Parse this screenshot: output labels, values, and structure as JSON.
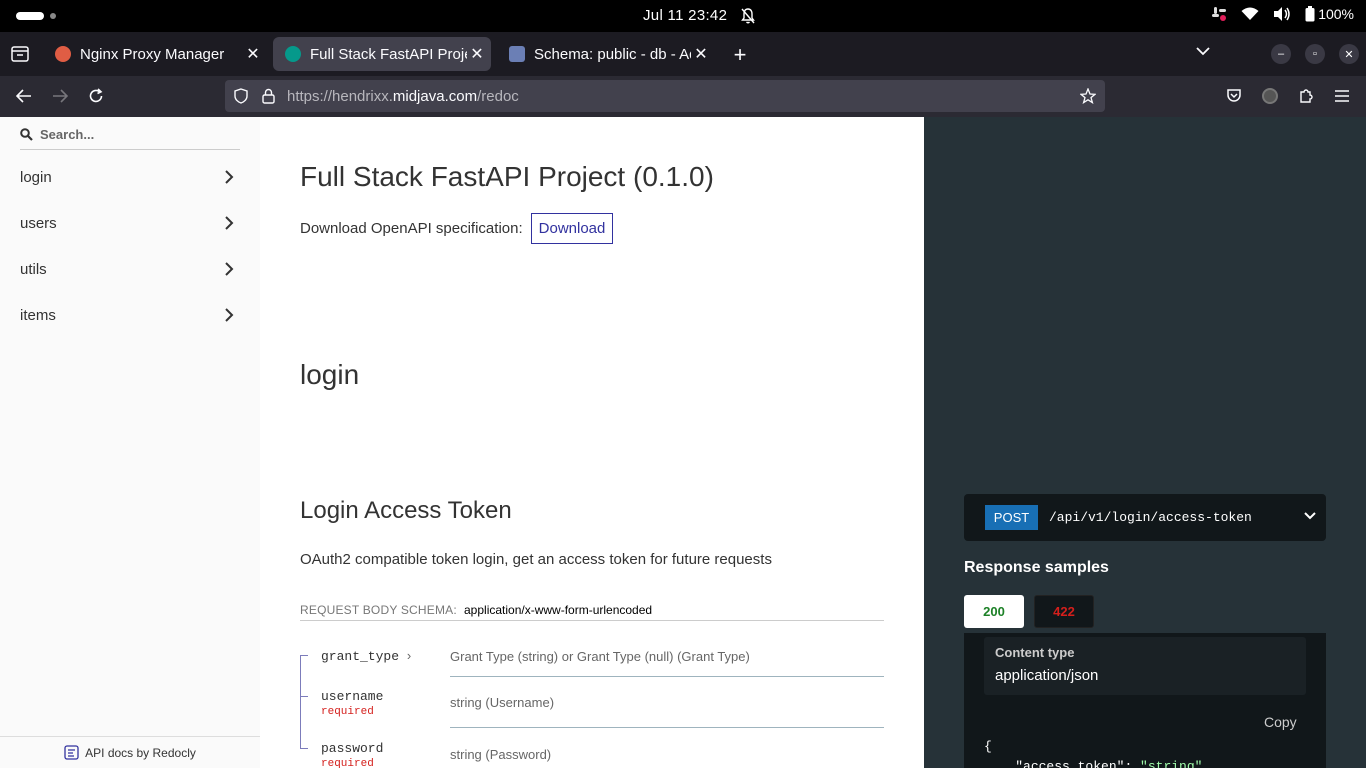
{
  "system": {
    "clock": "Jul 11  23:42",
    "battery": "100%"
  },
  "browser": {
    "tabs": [
      {
        "label": "Nginx Proxy Manager"
      },
      {
        "label": "Full Stack FastAPI Project"
      },
      {
        "label": "Schema: public - db - Adminer"
      }
    ],
    "url_prefix": "https://hendrixx.",
    "url_host": "midjava.com",
    "url_path": "/redoc"
  },
  "sidebar": {
    "search_placeholder": "Search...",
    "items": [
      {
        "label": "login"
      },
      {
        "label": "users"
      },
      {
        "label": "utils"
      },
      {
        "label": "items"
      }
    ],
    "footer": "API docs by Redocly"
  },
  "content": {
    "title": "Full Stack FastAPI Project (0.1.0)",
    "download_text": "Download OpenAPI specification:",
    "download_button": "Download",
    "section": "login",
    "op_title": "Login Access Token",
    "op_desc": "OAuth2 compatible token login, get an access token for future requests",
    "schema_label": "REQUEST BODY SCHEMA:",
    "schema_type": "application/x-www-form-urlencoded",
    "params": [
      {
        "name": "grant_type",
        "type": "Grant Type (string) or Grant Type (null) (Grant Type)",
        "required": ""
      },
      {
        "name": "username",
        "type": "string (Username)",
        "required": "required"
      },
      {
        "name": "password",
        "type": "string (Password)",
        "required": "required"
      }
    ]
  },
  "right_panel": {
    "method": "POST",
    "path": "/api/v1/login/access-token",
    "response_title": "Response samples",
    "codes": [
      "200",
      "422"
    ],
    "content_type_label": "Content type",
    "content_type_value": "application/json",
    "copy_label": "Copy",
    "json_open": "{",
    "json_key": "\"access_token\"",
    "json_val": "\"string\""
  },
  "colors": {
    "method_post": "#186fb5",
    "code_200": "#1d8127",
    "code_422": "#d41f1c",
    "panel_bg": "#263238",
    "link": "#32329f"
  }
}
